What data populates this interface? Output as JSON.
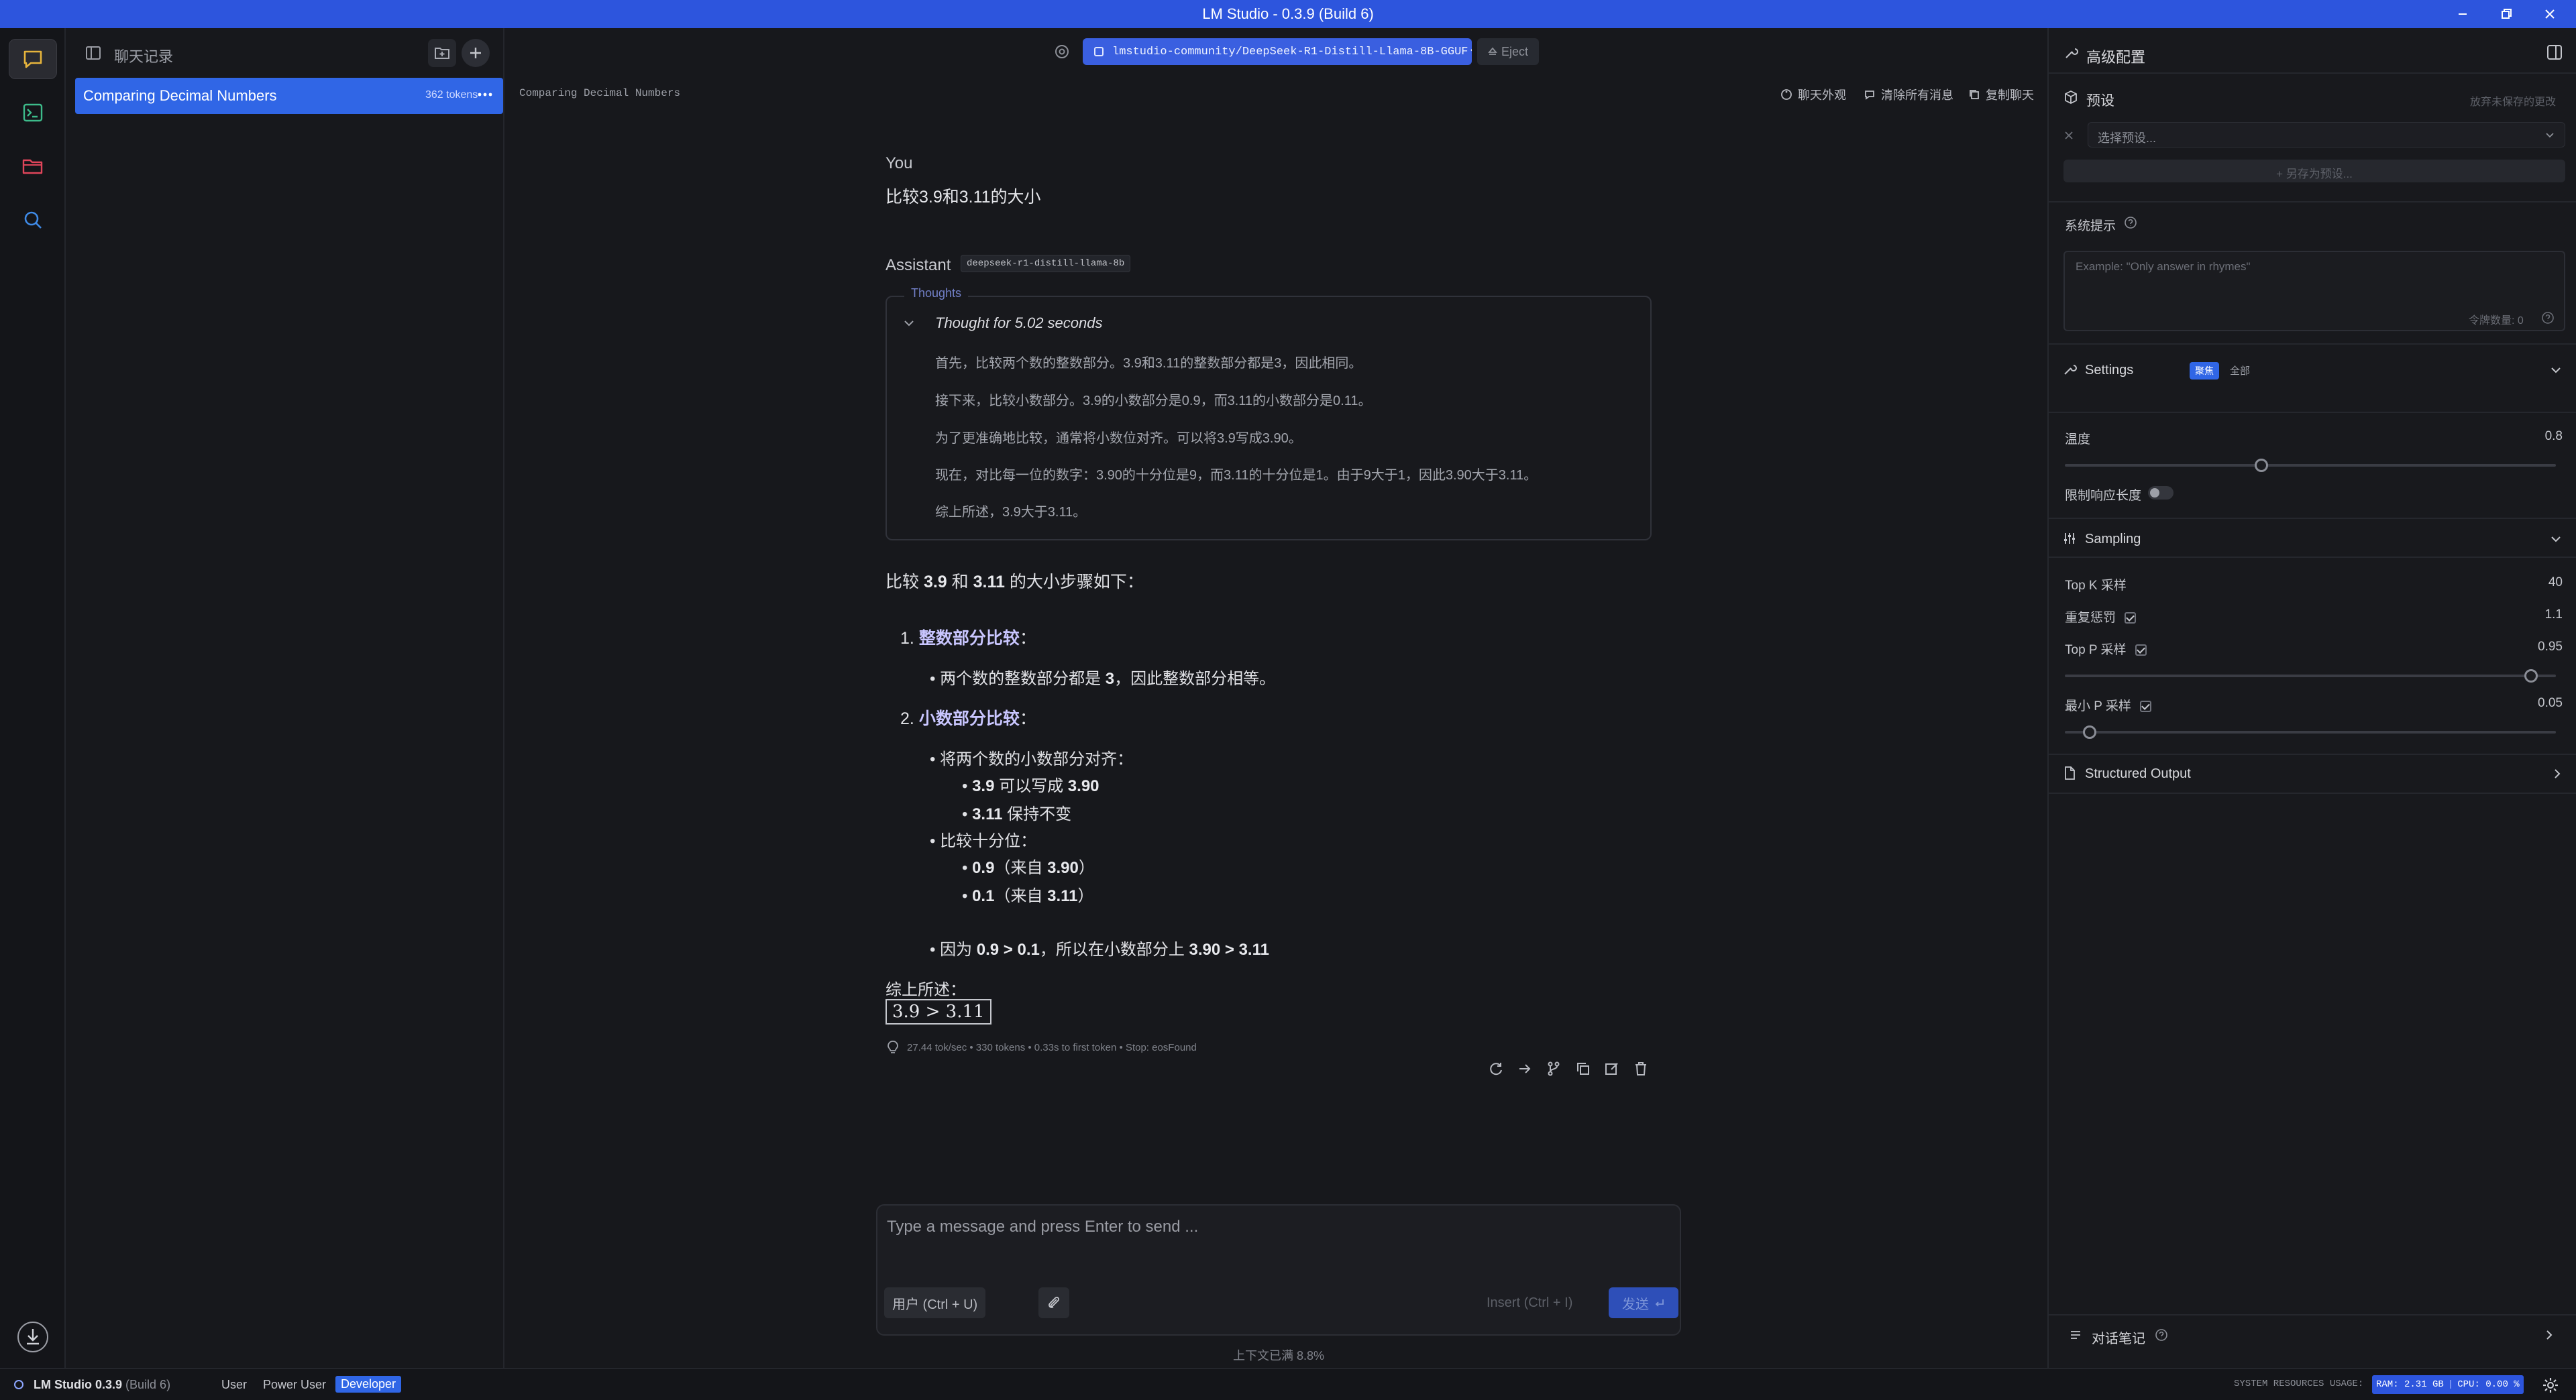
{
  "window": {
    "title": "LM Studio - 0.3.9 (Build 6)"
  },
  "sidebar_header": {
    "title": "聊天记录"
  },
  "chats": [
    {
      "title": "Comparing Decimal Numbers",
      "tokens": "362 tokens"
    }
  ],
  "topbar": {
    "chat_title": "Comparing Decimal Numbers",
    "model": "lmstudio-community/DeepSeek-R1-Distill-Llama-8B-GGUF",
    "eject": "Eject",
    "actions": {
      "appearance": "聊天外观",
      "clear": "清除所有消息",
      "copy": "复制聊天"
    }
  },
  "messages": {
    "user_role": "You",
    "user_text": "比较3.9和3.11的大小",
    "assistant_role": "Assistant",
    "assistant_model": "deepseek-r1-distill-llama-8b",
    "thoughts_label": "Thoughts",
    "thought_time": "Thought for 5.02 seconds",
    "thoughts": [
      "首先，比较两个数的整数部分。3.9和3.11的整数部分都是3，因此相同。",
      "接下来，比较小数部分。3.9的小数部分是0.9，而3.11的小数部分是0.11。",
      "为了更准确地比较，通常将小数位对齐。可以将3.9写成3.90。",
      "现在，对比每一位的数字：3.90的十分位是9，而3.11的十分位是1。由于9大于1，因此3.90大于3.11。",
      "综上所述，3.9大于3.11。"
    ],
    "intro": {
      "a": "比较 ",
      "b": "3.9",
      "c": " 和 ",
      "d": "3.11",
      "e": " 的大小步骤如下："
    },
    "step1": {
      "num": "1.",
      "title": "整数部分比较",
      "colon": "："
    },
    "step1_bullet": {
      "a": "两个数的整数部分都是 ",
      "b": "3",
      "c": "，因此整数部分相等。"
    },
    "step2": {
      "num": "2.",
      "title": "小数部分比较",
      "colon": "："
    },
    "b_align": "将两个数的小数部分对齐：",
    "b_align_1": {
      "a": "3.9",
      "b": " 可以写成 ",
      "c": "3.90"
    },
    "b_align_2": {
      "a": "3.11",
      "b": " 保持不变"
    },
    "b_tenth": "比较十分位：",
    "b_tenth_1": {
      "a": "0.9",
      "b": "（来自 ",
      "c": "3.90",
      "d": "）"
    },
    "b_tenth_2": {
      "a": "0.1",
      "b": "（来自 ",
      "c": "3.11",
      "d": "）"
    },
    "b_because": {
      "a": "因为 ",
      "b": "0.9 > 0.1",
      "c": "，所以在小数部分上 ",
      "d": "3.90 > 3.11"
    },
    "summary": "综上所述：",
    "result": "3.9 > 3.11",
    "stats": "27.44 tok/sec • 330 tokens • 0.33s to first token • Stop: eosFound"
  },
  "composer": {
    "placeholder": "Type a message and press Enter to send ...",
    "role": "用户 (Ctrl + U)",
    "insert": "Insert (Ctrl + I)",
    "send": "发送",
    "context": "上下文已满 8.8%"
  },
  "right": {
    "title": "高级配置",
    "preset_label": "预设",
    "preset_discard": "放弃未保存的更改",
    "preset_select": "选择预设...",
    "preset_save": "+ 另存为预设...",
    "system_prompt_label": "系统提示",
    "system_prompt_placeholder": "Example: \"Only answer in rhymes\"",
    "token_count": "令牌数量: 0",
    "settings_label": "Settings",
    "settings_badge": "聚焦",
    "settings_all": "全部",
    "temperature_label": "温度",
    "temperature_value": "0.8",
    "temperature": 0.8,
    "limit_length_label": "限制响应长度",
    "sampling_label": "Sampling",
    "topk_label": "Top K 采样",
    "topk_value": "40",
    "repeat_label": "重复惩罚",
    "repeat_value": "1.1",
    "topp_label": "Top P 采样",
    "topp_value": "0.95",
    "topp": 0.95,
    "minp_label": "最小 P 采样",
    "minp_value": "0.05",
    "minp": 0.05,
    "structured_label": "Structured Output",
    "notes_label": "对话笔记"
  },
  "statusbar": {
    "app": "LM Studio 0.3.9",
    "build": "(Build 6)",
    "modes": [
      "User",
      "Power User",
      "Developer"
    ],
    "resources_label": "SYSTEM RESOURCES USAGE:",
    "ram": "RAM: 2.31 GB",
    "cpu": "CPU: 0.00 %"
  },
  "colors": {
    "accent": "#2d55dd",
    "selected": "#3066e6",
    "background": "#17181c"
  }
}
